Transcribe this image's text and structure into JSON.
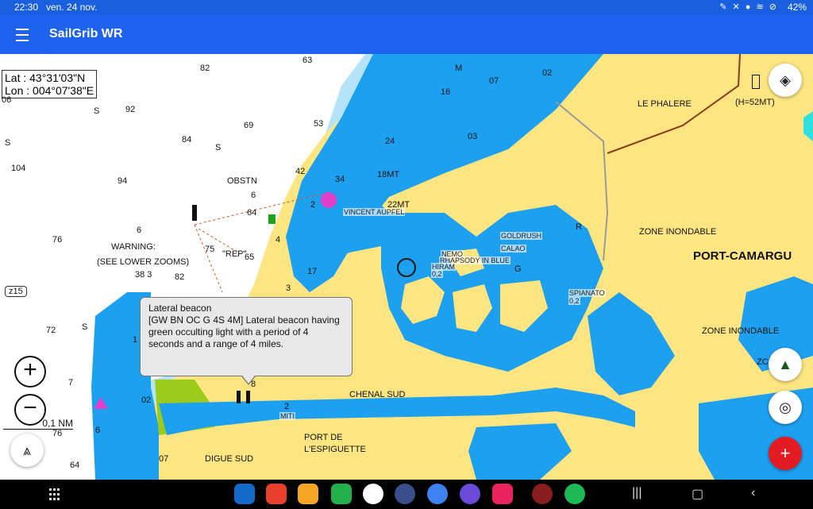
{
  "status_bar": {
    "time": "22:30",
    "date": "ven. 24 nov.",
    "battery": "42%"
  },
  "app_bar": {
    "title": "SailGrib WR"
  },
  "coordinates": {
    "lat_label": "Lat :",
    "lat_value": "43°31'03\"N",
    "lon_label": "Lon :",
    "lon_value": "004°07'38\"E"
  },
  "map_labels": {
    "le_phalere": "LE PHALERE",
    "h52": "(H=52MT)",
    "zone_inondable_1": "ZONE INONDABLE",
    "port_camargue": "PORT-CAMARGU",
    "zone_inondable_2": "ZONE INONDABLE",
    "zc": "ZC",
    "obstn": "OBSTN",
    "warning_1": "WARNING:",
    "warning_2": "(SEE LOWER ZOOMS)",
    "rep": "\"REP\"",
    "chenal_sud": "CHENAL SUD",
    "port_de": "PORT DE",
    "espiguette": "L'ESPIGUETTE",
    "digue_sud": "DIGUE SUD",
    "mt18": "18MT",
    "mt22": "22MT",
    "vincent": "VINCENT AUPFEL",
    "goldrush": "GOLDRUSH",
    "calao": "CALAO",
    "nemo": "NEMO",
    "rhapsody": "RHAPSODY IN BLUE",
    "hiram": "HIRAM",
    "v02a": "0,2",
    "spianato": "SPIANATO",
    "v02b": "0,2",
    "miti": "MITI",
    "m_letter": "M",
    "r_letter": "R",
    "g_letter": "G"
  },
  "depths": [
    "63",
    "82",
    "07",
    "02",
    "16",
    "92",
    "S",
    "53",
    "69",
    "S",
    "84",
    "S",
    "104",
    "24",
    "03",
    "94",
    "42",
    "6",
    "64",
    "34",
    "6",
    "76",
    "75",
    "65",
    "4",
    "17",
    "3",
    "38 3",
    "82",
    "72",
    "S",
    "1",
    "7",
    "02",
    "8",
    "6",
    "76",
    "64",
    "07",
    "06",
    "2",
    "2"
  ],
  "tooltip": {
    "title": "Lateral beacon",
    "body": "[GW BN OC G 4S 4M] Lateral beacon having green occulting light with a period of 4 seconds and a range of 4 miles."
  },
  "zoom": {
    "in": "+",
    "out": "−"
  },
  "scale_label": "0,1 NM",
  "z15": "z15",
  "fab": {
    "add": "+"
  },
  "colors": {
    "land": "#fde681",
    "deep_water": "#1ea0f0",
    "shallow_water": "#b5e3f9",
    "appbar": "#1e63f0",
    "fab_red": "#e31b23"
  }
}
